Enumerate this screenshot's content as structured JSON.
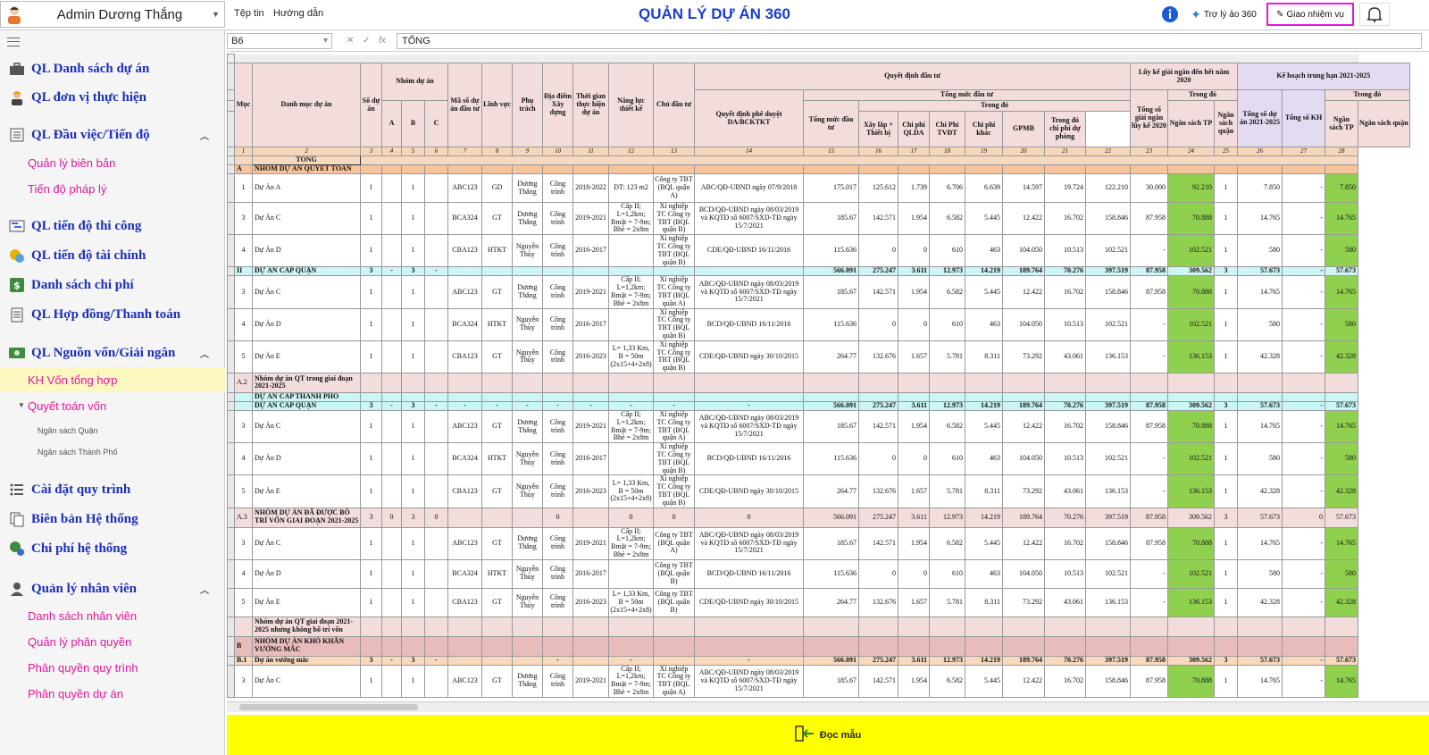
{
  "header": {
    "user": "Admin Dương Thắng",
    "menu": [
      "Tệp tin",
      "Hướng dẫn"
    ],
    "title": "QUẢN LÝ DỰ ÁN 360",
    "assistant": "Trợ lý ảo 360",
    "assign": "Giao nhiệm vụ"
  },
  "sidebar": {
    "items": [
      {
        "label": "QL Danh sách dự án",
        "icon": "briefcase-icon"
      },
      {
        "label": "QL đơn vị thực hiện",
        "icon": "worker-icon"
      },
      {
        "label": "QL Đầu việc/Tiến độ",
        "icon": "list-icon"
      },
      {
        "label": "QL tiến độ thi công",
        "icon": "gantt-icon"
      },
      {
        "label": "QL tiến độ tài chính",
        "icon": "coins-icon"
      },
      {
        "label": "Danh sách chi phí",
        "icon": "dollar-icon"
      },
      {
        "label": "QL Hợp đồng/Thanh toán",
        "icon": "document-icon"
      },
      {
        "label": "QL Nguồn vốn/Giải ngân",
        "icon": "money-icon"
      },
      {
        "label": "Cài đặt quy trình",
        "icon": "list-bullets-icon"
      },
      {
        "label": "Biên bản Hệ thống",
        "icon": "copy-icon"
      },
      {
        "label": "Chi phí hệ thống",
        "icon": "cost-icon"
      },
      {
        "label": "Quản lý nhân viên",
        "icon": "person-icon"
      }
    ],
    "sub_tasks": [
      "Quản lý biên bản",
      "Tiến độ pháp lý"
    ],
    "sub_funds": [
      "KH Vốn tổng hợp",
      "Quyết toán vốn"
    ],
    "sub_settle": [
      "Ngân sách Quận",
      "Ngân sách Thành Phố"
    ],
    "sub_staff": [
      "Danh sách nhân viên",
      "Quản lý phân quyền",
      "Phân quyền quy trình",
      "Phân quyền dự án"
    ]
  },
  "formula": {
    "cell": "B6",
    "value": "TỔNG"
  },
  "sheet": {
    "header": {
      "muc": "Mục",
      "danh_muc": "Danh mục dự án",
      "so_du_an": "Số dự án",
      "nhom": "Nhóm dự án",
      "ma_so": "Mã số dự án đầu tư",
      "linh_vuc": "Lĩnh vực",
      "phu_trach": "Phụ trách",
      "dia_diem": "Địa điểm Xây dựng",
      "thoi_gian": "Thời gian thực hiện dự án",
      "nang_luc": "Năng lực thiết kế",
      "chu_dau_tu": "Chủ đầu tư",
      "qd_dau_tu": "Quyết định đầu tư",
      "qd_phe_duyet": "Quyết định phê duyệt DA/BCKTKT",
      "tong_muc": "Tổng mức đầu tư",
      "tong_muc_dt": "Tổng mức đầu tư",
      "trong_do": "Trong đó",
      "xay_lap": "Xây lắp + Thiết bị",
      "cp_qlda": "Chi phí QLDA",
      "cp_tvdt": "Chi Phí TVĐT",
      "cp_khac": "Chi phí khác",
      "gpmb": "GPMB",
      "du_phong": "Trong đó chi phí dự phòng",
      "luy_ke": "Lũy kế giải ngân đến hết năm 2020",
      "tong_gn": "Tổng số giải ngân lũy kế 2020",
      "trong_do2": "Trong đó",
      "ns_tp": "Ngân sách TP",
      "ns_quan": "Ngân sách quận",
      "ke_hoach": "Kế hoạch trung hạn 2021-2025",
      "tong_so_du_an": "Tổng số dự án 2021-2025",
      "tong_kh": "Tổng số KH",
      "trong_do3": "Trong đó",
      "ns_tp2": "Ngân sách TP",
      "ns_quan2": "Ngân sách quận"
    },
    "col_numbers": [
      "1",
      "2",
      "3",
      "4",
      "5",
      "6",
      "7",
      "8",
      "9",
      "10",
      "11",
      "12",
      "13",
      "14",
      "15",
      "16",
      "17",
      "18",
      "19",
      "20",
      "21",
      "22",
      "23",
      "24",
      "25",
      "26",
      "27",
      "28"
    ],
    "total_label": "TỔNG",
    "rows": [
      {
        "t": "secA",
        "c": [
          "A",
          "NHÓM DỰ ÁN QUYẾT TOÁN",
          "",
          "",
          "",
          "",
          "",
          "",
          "",
          "",
          "",
          "",
          "",
          "",
          "",
          "",
          "",
          "",
          "",
          "",
          "",
          "",
          "",
          "",
          "",
          "",
          "",
          ""
        ]
      },
      {
        "t": "d",
        "c": [
          "1",
          "Dự Án A",
          "1",
          "",
          "1",
          "",
          "ABC123",
          "GD",
          "Dương Thắng",
          "Công trình",
          "2018-2022",
          "DT: 123 m2",
          "Công ty TBT (BQL quận A)",
          "ABC/QĐ-UBND ngày 07/9/2018",
          "175.017",
          "125.612",
          "1.739",
          "6.706",
          "6.639",
          "14.597",
          "19.724",
          "122.210",
          "30.000",
          "92.210",
          "1",
          "7.850",
          "-",
          "7.850"
        ]
      },
      {
        "t": "d",
        "c": [
          "3",
          "Dự Án C",
          "1",
          "",
          "1",
          "",
          "BCA324",
          "GT",
          "Dương Thắng",
          "Công trình",
          "2019-2021",
          "Cấp II; L=1,2km; Bmặt = 7-9m; Bhè = 2x8m",
          "Xí nghiệp TC Công ty TBT (BQL quận B)",
          "BCD/QĐ-UBND ngày 08/03/2019 và KQTĐ số 6007/SXD-TĐ ngày 15/7/2021",
          "185.67",
          "142.571",
          "1.954",
          "6.582",
          "5.445",
          "12.422",
          "16.702",
          "158.846",
          "87.958",
          "70.888",
          "1",
          "14.765",
          "-",
          "14.765"
        ]
      },
      {
        "t": "d",
        "c": [
          "4",
          "Dự Án D",
          "1",
          "",
          "1",
          "",
          "CBA123",
          "HTKT",
          "Nguyễn Thùy",
          "Công trình",
          "2016-2017",
          "",
          "Xí nghiệp TC Công ty TBT (BQL quận B)",
          "CDE/QĐ-UBND 16/11/2016",
          "115.636",
          "0",
          "0",
          "610",
          "463",
          "104.050",
          "10.513",
          "102.521",
          "-",
          "102.521",
          "1",
          "580",
          "-",
          "580"
        ]
      },
      {
        "t": "cyan",
        "c": [
          "II",
          "DỰ ÁN CẤP QUẬN",
          "3",
          "-",
          "3",
          "-",
          "",
          "",
          "",
          "",
          "",
          "",
          "",
          "",
          "566.091",
          "275.247",
          "3.611",
          "12.973",
          "14.219",
          "189.764",
          "70.276",
          "397.519",
          "87.958",
          "309.562",
          "3",
          "57.673",
          "-",
          "57.673"
        ]
      },
      {
        "t": "d",
        "c": [
          "3",
          "Dự Án C",
          "1",
          "",
          "1",
          "",
          "ABC123",
          "GT",
          "Dương Thắng",
          "Công trình",
          "2019-2021",
          "Cấp II; L=1,2km; Bmặt = 7-9m; Bhè = 2x8m",
          "Xí nghiệp TC Công ty TBT (BQL quận A)",
          "ABC/QĐ-UBND ngày 08/03/2019 và KQTĐ số 6007/SXD-TĐ ngày 15/7/2021",
          "185.67",
          "142.571",
          "1.954",
          "6.582",
          "5.445",
          "12.422",
          "16.702",
          "158.846",
          "87.958",
          "70.888",
          "1",
          "14.765",
          "-",
          "14.765"
        ]
      },
      {
        "t": "d",
        "c": [
          "4",
          "Dự Án D",
          "1",
          "",
          "1",
          "",
          "BCA324",
          "HTKT",
          "Nguyễn Thùy",
          "Công trình",
          "2016-2017",
          "",
          "Xí nghiệp TC Công ty TBT (BQL quận B)",
          "BCD/QĐ-UBND 16/11/2016",
          "115.636",
          "0",
          "0",
          "610",
          "463",
          "104.050",
          "10.513",
          "102.521",
          "-",
          "102.521",
          "1",
          "580",
          "-",
          "580"
        ]
      },
      {
        "t": "d",
        "c": [
          "5",
          "Dự Án E",
          "1",
          "",
          "1",
          "",
          "CBA123",
          "GT",
          "Nguyễn Thùy",
          "Công trình",
          "2016-2023",
          "L= 1,33 Km, B = 50m (2x15+4+2x8)",
          "Xí nghiệp TC Công ty TBT (BQL quận B)",
          "CDE/QĐ-UBND ngày 30/10/2015",
          "264.77",
          "132.676",
          "1.657",
          "5.781",
          "8.311",
          "73.292",
          "43.061",
          "136.153",
          "-",
          "136.153",
          "1",
          "42.328",
          "-",
          "42.328"
        ]
      },
      {
        "t": "pink",
        "c": [
          "A.2",
          "Nhóm dự án QT trong giai đoạn 2021-2025",
          "",
          "",
          "",
          "",
          "",
          "",
          "",
          "",
          "",
          "",
          "",
          "",
          "",
          "",
          "",
          "",
          "",
          "",
          "",
          "",
          "",
          "",
          "",
          "",
          "",
          ""
        ]
      },
      {
        "t": "cyan",
        "c": [
          "",
          "DỰ ÁN CẤP THÀNH PHỐ",
          "",
          "",
          "",
          "",
          "",
          "",
          "",
          "",
          "",
          "",
          "",
          "",
          "",
          "",
          "",
          "",
          "",
          "",
          "",
          "",
          "",
          "",
          "",
          "",
          "",
          ""
        ]
      },
      {
        "t": "cyan",
        "c": [
          "",
          "DỰ ÁN CẤP QUẬN",
          "3",
          "-",
          "3",
          "-",
          "-",
          "-",
          "-",
          "-",
          "-",
          "-",
          "-",
          "-",
          "566.091",
          "275.247",
          "3.611",
          "12.973",
          "14.219",
          "189.764",
          "70.276",
          "397.519",
          "87.958",
          "309.562",
          "3",
          "57.673",
          "-",
          "57.673"
        ]
      },
      {
        "t": "d",
        "c": [
          "3",
          "Dự Án C",
          "1",
          "",
          "1",
          "",
          "ABC123",
          "GT",
          "Dương Thắng",
          "Công trình",
          "2019-2021",
          "Cấp II; L=1,2km; Bmặt = 7-9m; Bhè = 2x8m",
          "Xí nghiệp TC Công ty TBT (BQL quận A)",
          "ABC/QĐ-UBND ngày 08/03/2019 và KQTĐ số 6007/SXD-TĐ ngày 15/7/2021",
          "185.67",
          "142.571",
          "1.954",
          "6.582",
          "5.445",
          "12.422",
          "16.702",
          "158.846",
          "87.958",
          "70.888",
          "1",
          "14.765",
          "-",
          "14.765"
        ]
      },
      {
        "t": "d",
        "c": [
          "4",
          "Dự Án D",
          "1",
          "",
          "1",
          "",
          "BCA324",
          "HTKT",
          "Nguyễn Thùy",
          "Công trình",
          "2016-2017",
          "",
          "Xí nghiệp TC Công ty TBT (BQL quận B)",
          "BCD/QĐ-UBND 16/11/2016",
          "115.636",
          "0",
          "0",
          "610",
          "463",
          "104.050",
          "10.513",
          "102.521",
          "-",
          "102.521",
          "1",
          "580",
          "-",
          "580"
        ]
      },
      {
        "t": "d",
        "c": [
          "5",
          "Dự Án E",
          "1",
          "",
          "1",
          "",
          "CBA123",
          "GT",
          "Nguyễn Thùy",
          "Công trình",
          "2016-2023",
          "L= 1,33 Km, B = 50m (2x15+4+2x8)",
          "Xí nghiệp TC Công ty TBT (BQL quận B)",
          "CDE/QĐ-UBND ngày 30/10/2015",
          "264.77",
          "132.676",
          "1.657",
          "5.781",
          "8.311",
          "73.292",
          "43.061",
          "136.153",
          "-",
          "136.153",
          "1",
          "42.328",
          "-",
          "42.328"
        ]
      },
      {
        "t": "pinkb",
        "c": [
          "A.3",
          "NHÓM DỰ ÁN ĐÃ ĐƯỢC BỐ TRÍ VỐN GIAI ĐOẠN 2021-2025",
          "3",
          "0",
          "3",
          "0",
          "",
          "",
          "",
          "0",
          "",
          "0",
          "0",
          "0",
          "566.091",
          "275.247",
          "3.611",
          "12.973",
          "14.219",
          "189.764",
          "70.276",
          "397.519",
          "87.958",
          "309.562",
          "3",
          "57.673",
          "0",
          "57.673"
        ]
      },
      {
        "t": "d",
        "c": [
          "3",
          "Dự Án C",
          "1",
          "",
          "1",
          "",
          "ABC123",
          "GT",
          "Dương Thắng",
          "Công trình",
          "2019-2021",
          "Cấp II; L=1,2km; Bmặt = 7-9m; Bhè = 2x8m",
          "Công ty TBT (BQL quận A)",
          "ABC/QĐ-UBND ngày 08/03/2019 và KQTĐ số 6007/SXD-TĐ ngày 15/7/2021",
          "185.67",
          "142.571",
          "1.954",
          "6.582",
          "5.445",
          "12.422",
          "16.702",
          "158.846",
          "87.958",
          "70.888",
          "1",
          "14.765",
          "-",
          "14.765"
        ]
      },
      {
        "t": "d",
        "c": [
          "4",
          "Dự Án D",
          "1",
          "",
          "1",
          "",
          "BCA324",
          "HTKT",
          "Nguyễn Thùy",
          "Công trình",
          "2016-2017",
          "",
          "Công ty TBT (BQL quận B)",
          "BCD/QĐ-UBND 16/11/2016",
          "115.636",
          "0",
          "0",
          "610",
          "463",
          "104.050",
          "10.513",
          "102.521",
          "-",
          "102.521",
          "1",
          "580",
          "-",
          "580"
        ]
      },
      {
        "t": "d",
        "c": [
          "5",
          "Dự Án E",
          "1",
          "",
          "1",
          "",
          "CBA123",
          "GT",
          "Nguyễn Thùy",
          "Công trình",
          "2016-2023",
          "L= 1,33 Km, B = 50m (2x15+4+2x8)",
          "Công ty TBT (BQL quận B)",
          "CDE/QĐ-UBND ngày 30/10/2015",
          "264.77",
          "132.676",
          "1.657",
          "5.781",
          "8.311",
          "73.292",
          "43.061",
          "136.153",
          "-",
          "136.153",
          "1",
          "42.328",
          "-",
          "42.328"
        ]
      },
      {
        "t": "pink",
        "c": [
          "",
          "Nhóm dự án QT giai đoạn 2021-2025 nhưng không bố trí vốn",
          "",
          "",
          "",
          "",
          "",
          "",
          "",
          "",
          "",
          "",
          "",
          "",
          "",
          "",
          "",
          "",
          "",
          "",
          "",
          "",
          "",
          "",
          "",
          "",
          "",
          ""
        ]
      },
      {
        "t": "pinkd",
        "c": [
          "B",
          "NHÓM DỰ ÁN KHÓ KHĂN VƯỚNG MẮC",
          "",
          "",
          "",
          "",
          "",
          "",
          "",
          "",
          "",
          "",
          "",
          "",
          "",
          "",
          "",
          "",
          "",
          "",
          "",
          "",
          "",
          "",
          "",
          "",
          "",
          ""
        ]
      },
      {
        "t": "tot",
        "c": [
          "B.1",
          "Dự án vướng mắc",
          "3",
          "-",
          "3",
          "-",
          "",
          "",
          "",
          "-",
          "",
          "-",
          "",
          "-",
          "566.091",
          "275.247",
          "3.611",
          "12.973",
          "14.219",
          "189.764",
          "70.276",
          "397.519",
          "87.958",
          "309.562",
          "3",
          "57.673",
          "-",
          "57.673"
        ]
      },
      {
        "t": "d",
        "c": [
          "3",
          "Dự Án C",
          "1",
          "",
          "1",
          "",
          "ABC123",
          "GT",
          "Dương Thắng",
          "Công trình",
          "2019-2021",
          "Cấp II; L=1,2km; Bmặt = 7-9m; Bhè = 2x8m",
          "Xí nghiệp TC Công ty TBT (BQL quận A)",
          "ABC/QĐ-UBND ngày 08/03/2019 và KQTĐ số 6007/SXD-TĐ ngày 15/7/2021",
          "185.67",
          "142.571",
          "1.954",
          "6.582",
          "5.445",
          "12.422",
          "16.702",
          "158.846",
          "87.958",
          "70.888",
          "1",
          "14.765",
          "-",
          "14.765"
        ]
      }
    ]
  },
  "footer": {
    "label": "Đọc mẫu"
  },
  "colors": {
    "accent": "#1c2fb8",
    "link": "#e01a9c",
    "green": "#8fd14f",
    "footer": "#ffff00"
  }
}
